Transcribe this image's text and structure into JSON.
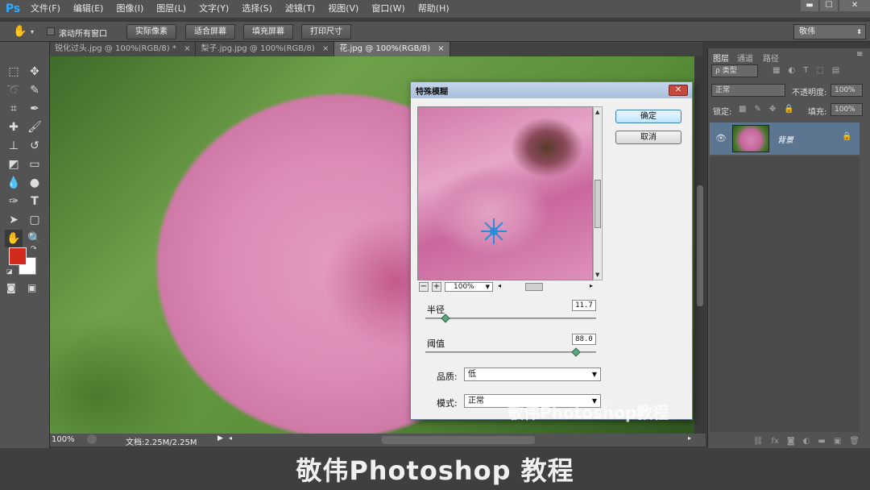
{
  "menubar": {
    "logo": "Ps",
    "items": [
      "文件(F)",
      "编辑(E)",
      "图像(I)",
      "图层(L)",
      "文字(Y)",
      "选择(S)",
      "滤镜(T)",
      "视图(V)",
      "窗口(W)",
      "帮助(H)"
    ],
    "min": "▬",
    "max": "☐",
    "close": "✕"
  },
  "options": {
    "scroll_all": "滚动所有窗口",
    "buttons": [
      "实际像素",
      "适合屏幕",
      "填充屏幕",
      "打印尺寸"
    ],
    "workspace": "敬伟"
  },
  "tabs": [
    {
      "label": "锐化过头.jpg @ 100%(RGB/8) *",
      "close": "×"
    },
    {
      "label": "梨子.jpg.jpg @ 100%(RGB/8)",
      "close": "×"
    },
    {
      "label": "花.jpg @ 100%(RGB/8)",
      "close": "×"
    }
  ],
  "status": {
    "zoom": "100%",
    "doc": "文档:2.25M/2.25M"
  },
  "panel": {
    "tabs": [
      "图层",
      "通道",
      "路径"
    ],
    "kind": "ρ 类型",
    "blend": "正常",
    "opacity_label": "不透明度:",
    "opacity": "100%",
    "lock_label": "锁定:",
    "fill_label": "填充:",
    "fill": "100%",
    "layer_name": "背景"
  },
  "dialog": {
    "title": "特殊模糊",
    "ok": "确定",
    "cancel": "取消",
    "zoom": "100%",
    "radius_label": "半径",
    "radius_value": "11.7",
    "radius_fraction": 0.12,
    "threshold_label": "阈值",
    "threshold_value": "88.0",
    "threshold_fraction": 0.88,
    "quality_label": "品质:",
    "quality_value": "低",
    "mode_label": "模式:",
    "mode_value": "正常",
    "watermark": "敬伟Photoshop教程"
  },
  "brand": "敬伟Photoshop 教程",
  "colors": {
    "foreground": "#d42a1e",
    "background": "#ffffff"
  }
}
